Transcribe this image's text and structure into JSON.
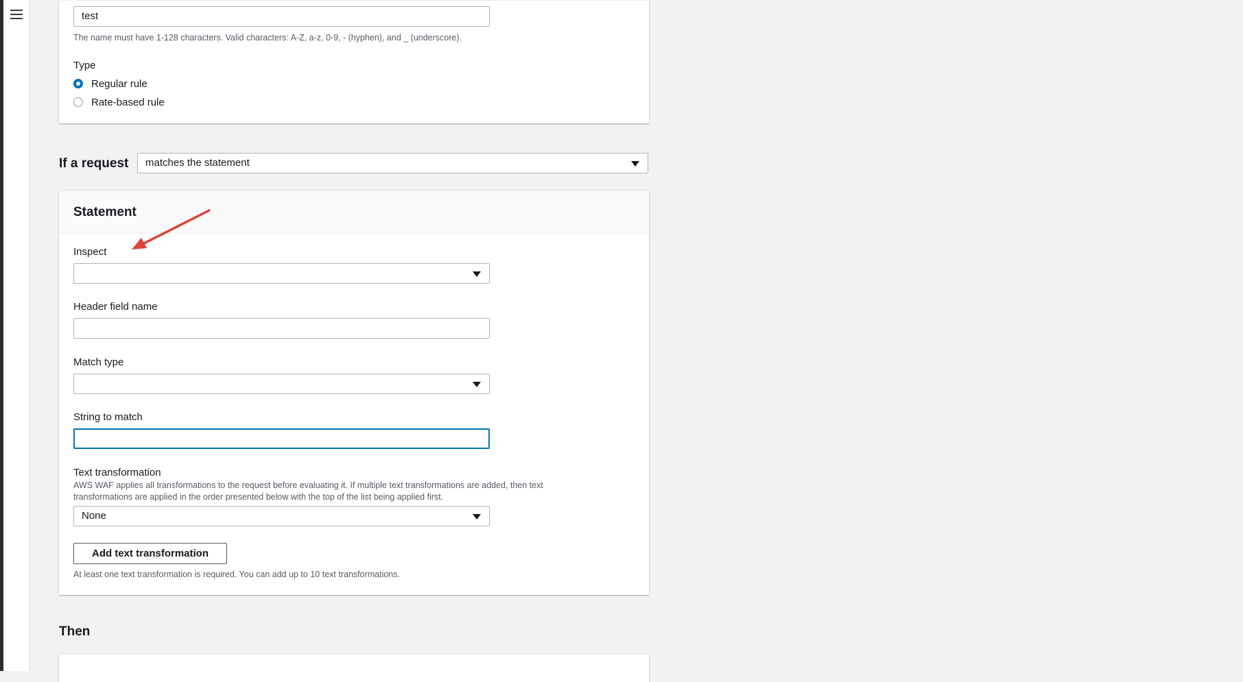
{
  "nav": {
    "menu_icon": "hamburger-menu-icon"
  },
  "rule": {
    "name_value": "test",
    "name_hint": "The name must have 1-128 characters. Valid characters: A-Z, a-z, 0-9, - (hyphen), and _ (underscore).",
    "type_label": "Type",
    "type_options": [
      "Regular rule",
      "Rate-based rule"
    ],
    "type_selected": "Regular rule"
  },
  "request": {
    "label": "If a request",
    "selected": "matches the statement"
  },
  "statement": {
    "title": "Statement",
    "inspect_label": "Inspect",
    "inspect_value": "",
    "header_field_label": "Header field name",
    "header_field_value": "",
    "match_type_label": "Match type",
    "match_type_value": "",
    "string_label": "String to match",
    "string_value": "",
    "text_transformation_label": "Text transformation",
    "text_transformation_hint_1": "AWS WAF applies all transformations to the request before evaluating it. If multiple text transformations are added, then text",
    "text_transformation_hint_2": "transformations are applied in the order presented below with the top of the list being applied first.",
    "text_transformation_value": "None",
    "add_button": "Add text transformation",
    "add_hint": "At least one text transformation is required. You can add up to 10 text transformations."
  },
  "then": {
    "heading": "Then"
  },
  "colors": {
    "accent": "#0073bb",
    "annotation_arrow": "#e0413b"
  }
}
